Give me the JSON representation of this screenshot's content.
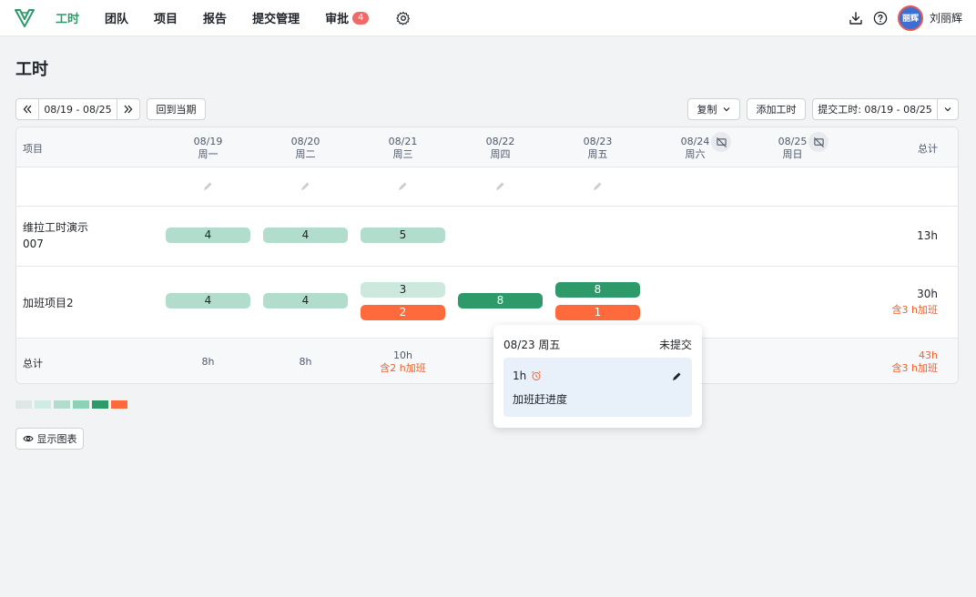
{
  "nav": {
    "items": [
      {
        "label": "工时",
        "active": true
      },
      {
        "label": "团队"
      },
      {
        "label": "项目"
      },
      {
        "label": "报告"
      },
      {
        "label": "提交管理"
      },
      {
        "label": "审批",
        "badge": "4"
      }
    ],
    "user_name": "刘丽辉",
    "avatar_text": "丽辉"
  },
  "page_title": "工时",
  "toolbar": {
    "prev_label": "«",
    "range_label": "08/19 - 08/25",
    "next_label": "»",
    "today_label": "回到当期",
    "copy_label": "复制",
    "add_label": "添加工时",
    "submit_label": "提交工时: 08/19 - 08/25"
  },
  "table": {
    "project_header": "项目",
    "total_header": "总计",
    "days": [
      {
        "date": "08/19",
        "weekday": "周一"
      },
      {
        "date": "08/20",
        "weekday": "周二"
      },
      {
        "date": "08/21",
        "weekday": "周三"
      },
      {
        "date": "08/22",
        "weekday": "周四"
      },
      {
        "date": "08/23",
        "weekday": "周五"
      },
      {
        "date": "08/24",
        "weekday": "周六",
        "hidden": true
      },
      {
        "date": "08/25",
        "weekday": "周日",
        "hidden": true
      }
    ],
    "rows": [
      {
        "project": "维拉工时演示 007",
        "cells": [
          "4",
          "4",
          "5",
          "",
          "",
          "",
          ""
        ],
        "total": "13h"
      },
      {
        "project": "加班项目2",
        "cells": [
          "4",
          "4",
          "3",
          "8",
          "8",
          "",
          ""
        ],
        "overtime": [
          "",
          "",
          "2",
          "",
          "1",
          "",
          ""
        ],
        "total": "30h",
        "total_overtime": "含3 h加班"
      }
    ],
    "footer": {
      "label": "总计",
      "days": [
        "8h",
        "8h",
        "10h",
        "",
        "",
        "",
        ""
      ],
      "days_overtime": [
        "",
        "",
        "含2 h加班",
        "",
        "",
        "",
        ""
      ],
      "total": "43h",
      "total_overtime": "含3 h加班"
    }
  },
  "legend_colors": [
    "#dfe7e4",
    "#d0ebe1",
    "#b2ddcc",
    "#8fd1b6",
    "#2e9a6a",
    "#ff6a3d"
  ],
  "chart_button_label": "显示图表",
  "popover": {
    "date": "08/23 周五",
    "status": "未提交",
    "hours": "1h",
    "note": "加班赶进度"
  },
  "colors": {
    "accent": "#2e9a6a",
    "overtime": "#ff6a3d"
  }
}
